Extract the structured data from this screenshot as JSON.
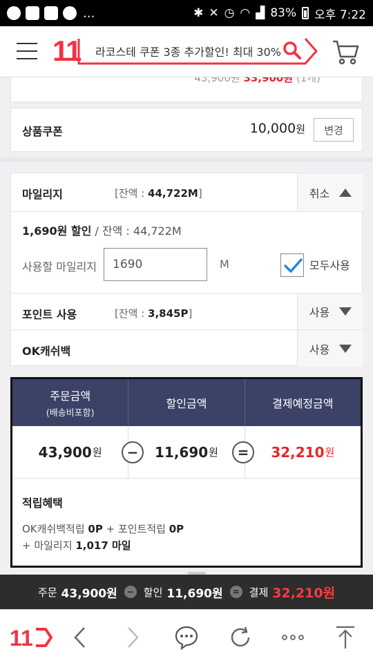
{
  "status_bar": {
    "battery": "83%",
    "time": "오후 7:22",
    "overflow": "..."
  },
  "header": {
    "logo": "11",
    "search_text": "라코스테 쿠폰 3종 추가할인! 최대 30%"
  },
  "prev_row": {
    "price_text": "43,900원",
    "red_text": "33,900원",
    "suffix": "(1개)"
  },
  "coupon": {
    "label": "상품쿠폰",
    "amount": "10,000",
    "unit": "원",
    "change_button": "변경"
  },
  "mileage": {
    "label": "마일리지",
    "balance_prefix": "[잔액 : ",
    "balance_value": "44,722M",
    "balance_suffix": "]",
    "cancel_button": "취소",
    "discount_amount": "1,690원 할인",
    "discount_rest": " / 잔액 : 44,722M",
    "use_label": "사용할 마일리지",
    "use_value": "1690",
    "unit": "M",
    "all_use_label": "모두사용",
    "all_use_checked": true
  },
  "point": {
    "label": "포인트 사용",
    "balance_prefix": "[잔액 : ",
    "balance_value": "3,845P",
    "balance_suffix": "]",
    "action": "사용"
  },
  "okcashbag": {
    "label": "OK캐쉬백",
    "action": "사용"
  },
  "summary": {
    "headers": {
      "order": "주문금액",
      "order_sub": "(배송비포함)",
      "discount": "할인금액",
      "payment": "결제예정금액"
    },
    "order_amount": "43,900",
    "discount_amount": "11,690",
    "payment_amount": "32,210",
    "unit": "원",
    "minus": "−",
    "equals": "=",
    "benefit_title": "적립혜택",
    "benefit_line1_a": "OK캐쉬백적립 ",
    "benefit_line1_b": "0P",
    "benefit_line1_c": " + 포인트적립 ",
    "benefit_line1_d": "0P",
    "benefit_line2_a": "+ 마일리지 ",
    "benefit_line2_b": "1,017 마일"
  },
  "paybar": {
    "order_label": "주문",
    "order_value": "43,900원",
    "discount_label": "할인",
    "discount_value": "11,690원",
    "pay_label": "결제",
    "pay_value": "32,210원",
    "minus": "−",
    "equals": "="
  },
  "colors": {
    "brand_red": "#f43142",
    "summary_header": "#3b4266",
    "price_red": "#e52528",
    "check_blue": "#1e88e5"
  },
  "bottom_nav": {
    "icons": [
      "11st-logo-icon",
      "back-icon",
      "forward-icon",
      "chat-icon",
      "refresh-icon",
      "more-icon",
      "scroll-top-icon"
    ]
  }
}
